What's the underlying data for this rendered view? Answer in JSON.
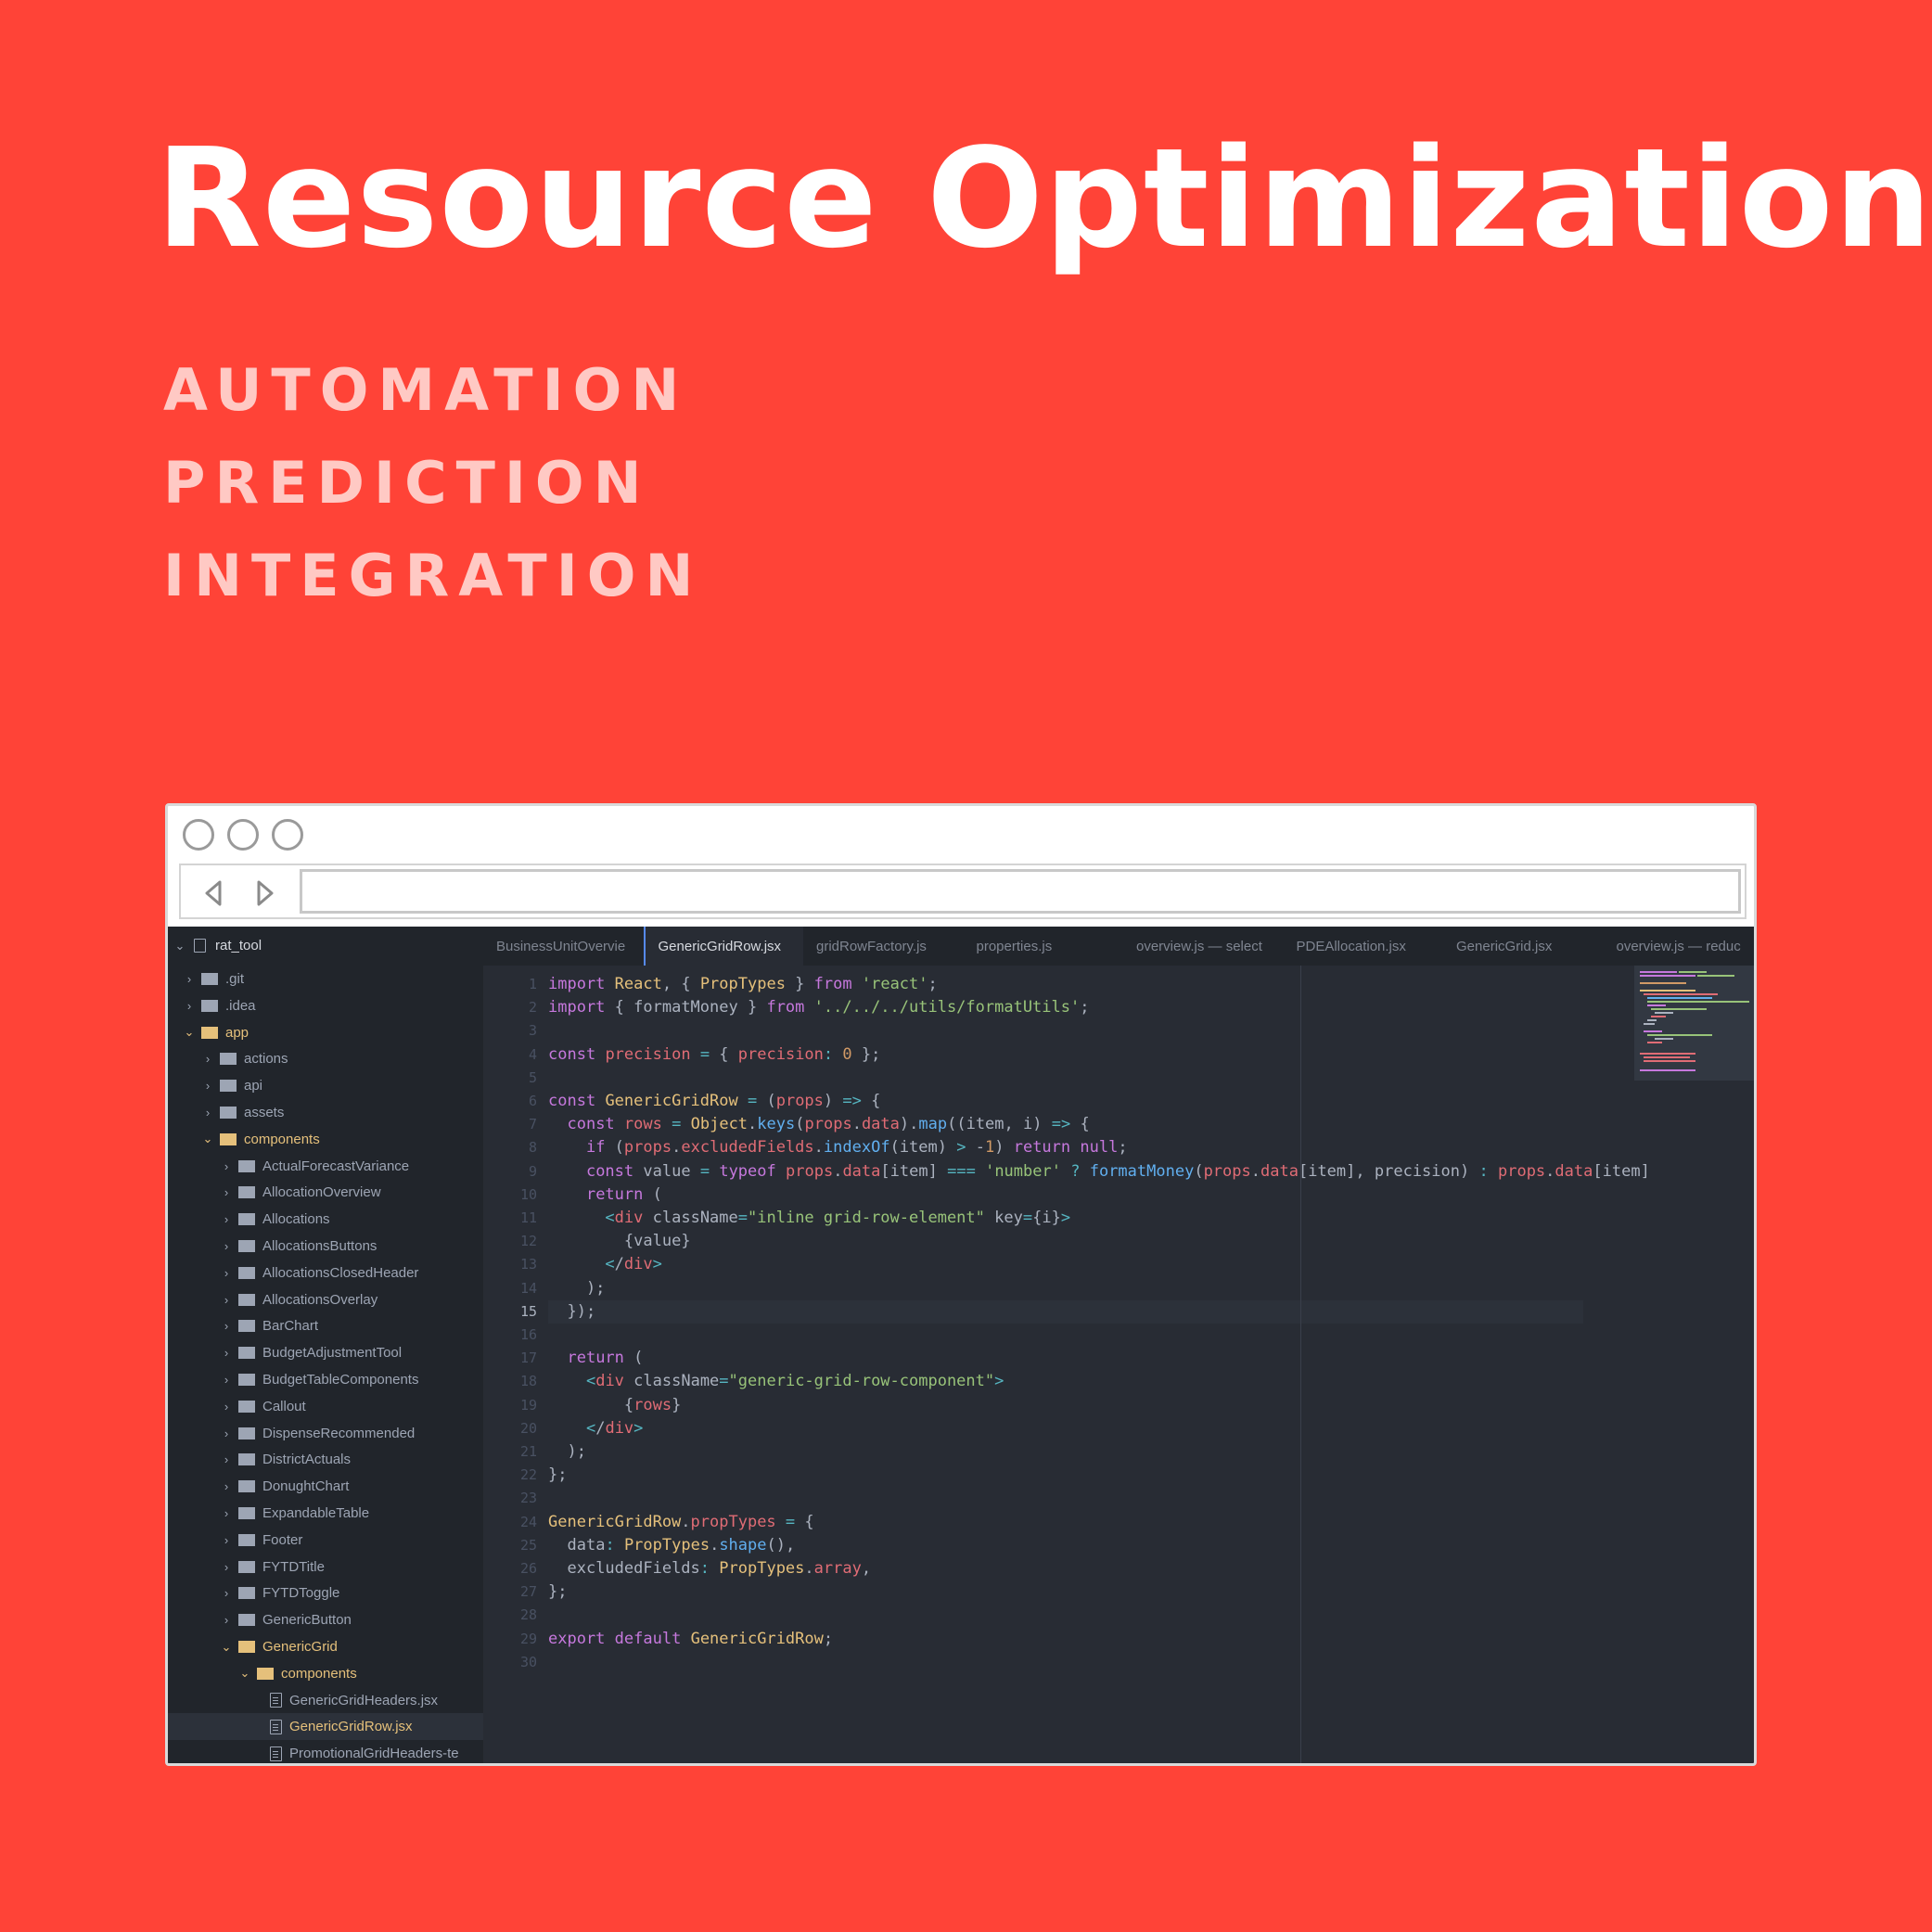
{
  "headline": "Resource Optimization",
  "subtitles": [
    "AUTOMATION",
    "PREDICTION",
    "INTEGRATION"
  ],
  "editor": {
    "project": "rat_tool",
    "tree": [
      {
        "label": ".git",
        "type": "folder",
        "depth": 1,
        "open": false
      },
      {
        "label": ".idea",
        "type": "folder",
        "depth": 1,
        "open": false
      },
      {
        "label": "app",
        "type": "folder",
        "depth": 1,
        "open": true,
        "highlight": true
      },
      {
        "label": "actions",
        "type": "folder",
        "depth": 2,
        "open": false
      },
      {
        "label": "api",
        "type": "folder",
        "depth": 2,
        "open": false
      },
      {
        "label": "assets",
        "type": "folder",
        "depth": 2,
        "open": false
      },
      {
        "label": "components",
        "type": "folder",
        "depth": 2,
        "open": true,
        "highlight": true
      },
      {
        "label": "ActualForecastVariance",
        "type": "folder",
        "depth": 3,
        "open": false
      },
      {
        "label": "AllocationOverview",
        "type": "folder",
        "depth": 3,
        "open": false
      },
      {
        "label": "Allocations",
        "type": "folder",
        "depth": 3,
        "open": false
      },
      {
        "label": "AllocationsButtons",
        "type": "folder",
        "depth": 3,
        "open": false
      },
      {
        "label": "AllocationsClosedHeader",
        "type": "folder",
        "depth": 3,
        "open": false
      },
      {
        "label": "AllocationsOverlay",
        "type": "folder",
        "depth": 3,
        "open": false
      },
      {
        "label": "BarChart",
        "type": "folder",
        "depth": 3,
        "open": false
      },
      {
        "label": "BudgetAdjustmentTool",
        "type": "folder",
        "depth": 3,
        "open": false
      },
      {
        "label": "BudgetTableComponents",
        "type": "folder",
        "depth": 3,
        "open": false
      },
      {
        "label": "Callout",
        "type": "folder",
        "depth": 3,
        "open": false
      },
      {
        "label": "DispenseRecommended",
        "type": "folder",
        "depth": 3,
        "open": false
      },
      {
        "label": "DistrictActuals",
        "type": "folder",
        "depth": 3,
        "open": false
      },
      {
        "label": "DonughtChart",
        "type": "folder",
        "depth": 3,
        "open": false
      },
      {
        "label": "ExpandableTable",
        "type": "folder",
        "depth": 3,
        "open": false
      },
      {
        "label": "Footer",
        "type": "folder",
        "depth": 3,
        "open": false
      },
      {
        "label": "FYTDTitle",
        "type": "folder",
        "depth": 3,
        "open": false
      },
      {
        "label": "FYTDToggle",
        "type": "folder",
        "depth": 3,
        "open": false
      },
      {
        "label": "GenericButton",
        "type": "folder",
        "depth": 3,
        "open": false
      },
      {
        "label": "GenericGrid",
        "type": "folder",
        "depth": 3,
        "open": true,
        "highlight": true
      },
      {
        "label": "components",
        "type": "folder",
        "depth": 4,
        "open": true,
        "highlight": true
      },
      {
        "label": "GenericGridHeaders.jsx",
        "type": "file",
        "depth": 5
      },
      {
        "label": "GenericGridRow.jsx",
        "type": "file",
        "depth": 5,
        "selected": true,
        "highlight": true
      },
      {
        "label": "PromotionalGridHeaders-te",
        "type": "file",
        "depth": 5
      }
    ],
    "tabs": [
      "BusinessUnitOvervie",
      "GenericGridRow.jsx",
      "gridRowFactory.js",
      "properties.js",
      "overview.js — select",
      "PDEAllocation.jsx",
      "GenericGrid.jsx",
      "overview.js — reduc"
    ],
    "active_tab": 1,
    "current_line": 15,
    "code_lines": [
      "import React, { PropTypes } from 'react';",
      "import { formatMoney } from '../../../utils/formatUtils';",
      "",
      "const precision = { precision: 0 };",
      "",
      "const GenericGridRow = (props) => {",
      "  const rows = Object.keys(props.data).map((item, i) => {",
      "    if (props.excludedFields.indexOf(item) > -1) return null;",
      "    const value = typeof props.data[item] === 'number' ? formatMoney(props.data[item], precision) : props.data[item]",
      "    return (",
      "      <div className=\"inline grid-row-element\" key={i}>",
      "        {value}",
      "      </div>",
      "    );",
      "  });",
      "",
      "  return (",
      "    <div className=\"generic-grid-row-component\">",
      "        {rows}",
      "    </div>",
      "  );",
      "};",
      "",
      "GenericGridRow.propTypes = {",
      "  data: PropTypes.shape(),",
      "  excludedFields: PropTypes.array,",
      "};",
      "",
      "export default GenericGridRow;",
      ""
    ]
  },
  "colors": {
    "background": "#ff4337",
    "headline": "#ffffff",
    "subtitle": "#ffc9c4",
    "editor_bg": "#282c34",
    "sidebar_bg": "#21252b",
    "folder_highlight": "#e5c07b"
  }
}
